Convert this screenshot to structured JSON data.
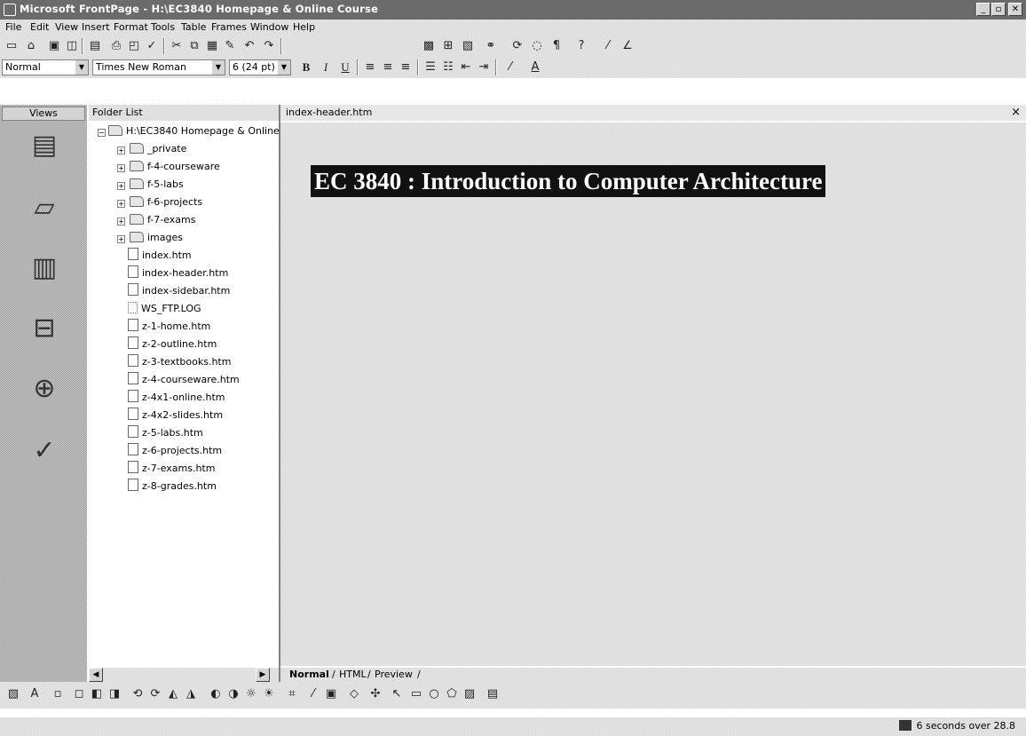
{
  "window": {
    "title": "Microsoft FrontPage - H:\\EC3840 Homepage & Online Course",
    "buttons": {
      "minimize": "_",
      "maximize": "▫",
      "close": "✕"
    }
  },
  "menu": [
    {
      "label": "File"
    },
    {
      "label": "Edit"
    },
    {
      "label": "View"
    },
    {
      "label": "Insert"
    },
    {
      "label": "Format"
    },
    {
      "label": "Tools"
    },
    {
      "label": "Table"
    },
    {
      "label": "Frames"
    },
    {
      "label": "Window"
    },
    {
      "label": "Help"
    }
  ],
  "formatting": {
    "style": "Normal",
    "font": "Times New Roman",
    "size": "6 (24 pt)"
  },
  "views_panel": {
    "header": "Views",
    "icons": [
      "page-view-icon",
      "folders-view-icon",
      "reports-view-icon",
      "navigation-view-icon",
      "hyperlinks-view-icon",
      "tasks-view-icon"
    ]
  },
  "folder_list": {
    "header": "Folder List",
    "root": "H:\\EC3840 Homepage & Online",
    "folders": [
      "_private",
      "f-4-courseware",
      "f-5-labs",
      "f-6-projects",
      "f-7-exams",
      "images"
    ],
    "files": [
      "index.htm",
      "index-header.htm",
      "index-sidebar.htm",
      "WS_FTP.LOG",
      "z-1-home.htm",
      "z-2-outline.htm",
      "z-3-textbooks.htm",
      "z-4-courseware.htm",
      "z-4x1-online.htm",
      "z-4x2-slides.htm",
      "z-5-labs.htm",
      "z-6-projects.htm",
      "z-7-exams.htm",
      "z-8-grades.htm"
    ]
  },
  "editor": {
    "tab": "index-header.htm",
    "close": "×",
    "heading": "EC 3840 : Introduction to Computer Architecture",
    "view_tabs": [
      "Normal",
      "HTML",
      "Preview"
    ]
  },
  "status": {
    "text": "6 seconds over 28.8"
  }
}
